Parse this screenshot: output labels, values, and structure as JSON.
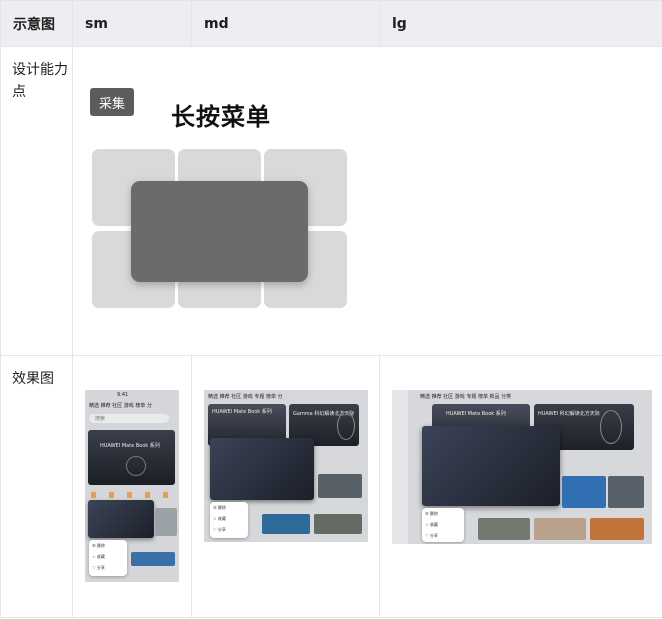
{
  "table": {
    "headers": [
      "示意图",
      "sm",
      "md",
      "lg"
    ],
    "rows": [
      {
        "label": "设计能力点"
      },
      {
        "label": "效果图"
      }
    ]
  },
  "illustration": {
    "badge": "采集",
    "title": "长按菜单"
  },
  "phone": {
    "time": "9:41",
    "tabs": "精选  推荐  社区  游戏  榜单  分",
    "search": "搜索",
    "banner": "HUAWEI Mate Book 系列",
    "menu": [
      "删除",
      "收藏",
      "分享"
    ]
  },
  "tablet": {
    "tabs": "精选  推荐  社区  游戏  专题  榜单  分",
    "card1": "HUAWEI Mate Book 系列",
    "card2": "Gamma 科幻解读北方天际",
    "menu": [
      "删除",
      "收藏",
      "分享"
    ]
  },
  "desktop": {
    "tabs": "精选  推荐  社区  游戏  专题  榜单  新品  分类",
    "card1": "HUAWEI Mate Book 系列",
    "card2": "HUAWEI 科幻解读北方天际",
    "menu": [
      "删除",
      "收藏",
      "分享"
    ]
  }
}
